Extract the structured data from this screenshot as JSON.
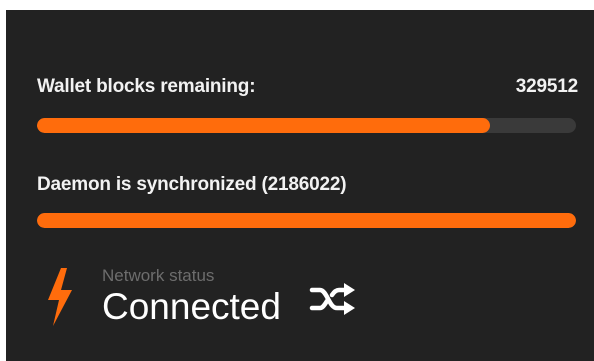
{
  "wallet": {
    "label": "Wallet blocks remaining:",
    "blocks_remaining": "329512",
    "progress": 0.84
  },
  "daemon": {
    "label": "Daemon is synchronized (2186022)",
    "progress": 1.0
  },
  "network": {
    "caption": "Network status",
    "status": "Connected",
    "status_icon": "lightning-bolt-icon",
    "mode_icon": "shuffle-icon"
  },
  "colors": {
    "panel_bg": "#222222",
    "accent": "#ff6c0c",
    "track": "#3a3a3a",
    "caption": "#6d6d6d"
  }
}
